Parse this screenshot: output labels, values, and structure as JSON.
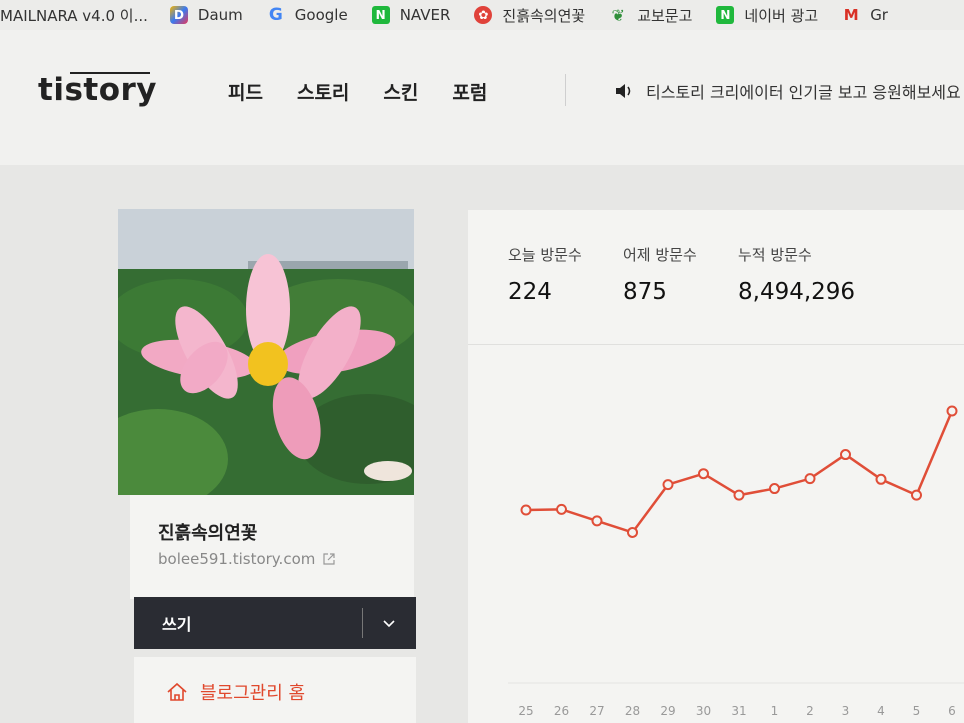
{
  "bookmarks": [
    {
      "label": "MAILNARA v4.0  이...",
      "icon": "none"
    },
    {
      "label": "Daum",
      "icon": "daum-icon"
    },
    {
      "label": "Google",
      "icon": "google-icon"
    },
    {
      "label": "NAVER",
      "icon": "naver-icon"
    },
    {
      "label": "진흙속의연꽃",
      "icon": "flower-icon"
    },
    {
      "label": "교보문고",
      "icon": "kyobo-icon"
    },
    {
      "label": "네이버 광고",
      "icon": "naver-icon"
    },
    {
      "label": "Gr",
      "icon": "gmail-icon"
    }
  ],
  "header": {
    "logo": "tistory",
    "nav": [
      "피드",
      "스토리",
      "스킨",
      "포럼"
    ],
    "notice": "티스토리 크리에이터 인기글 보고 응원해보세요"
  },
  "profile": {
    "blog_name": "진흙속의연꽃",
    "blog_url": "bolee591.tistory.com",
    "write_label": "쓰기",
    "manage_label": "블로그관리 홈"
  },
  "stats": {
    "today_label": "오늘 방문수",
    "today_value": "224",
    "yesterday_label": "어제 방문수",
    "yesterday_value": "875",
    "total_label": "누적 방문수",
    "total_value": "8,494,296"
  },
  "colors": {
    "accent": "#e0482d",
    "line": "#e04e38",
    "write_bar": "#2a2c33"
  },
  "chart_data": {
    "type": "line",
    "categories": [
      "25",
      "26",
      "27",
      "28",
      "29",
      "30",
      "31",
      "1",
      "2",
      "3",
      "4",
      "5",
      "6"
    ],
    "values": [
      500,
      502,
      467,
      432,
      577,
      610,
      545,
      565,
      595,
      668,
      593,
      545,
      800
    ],
    "ylim": [
      0,
      1000
    ],
    "grid": false,
    "legend": "none"
  }
}
